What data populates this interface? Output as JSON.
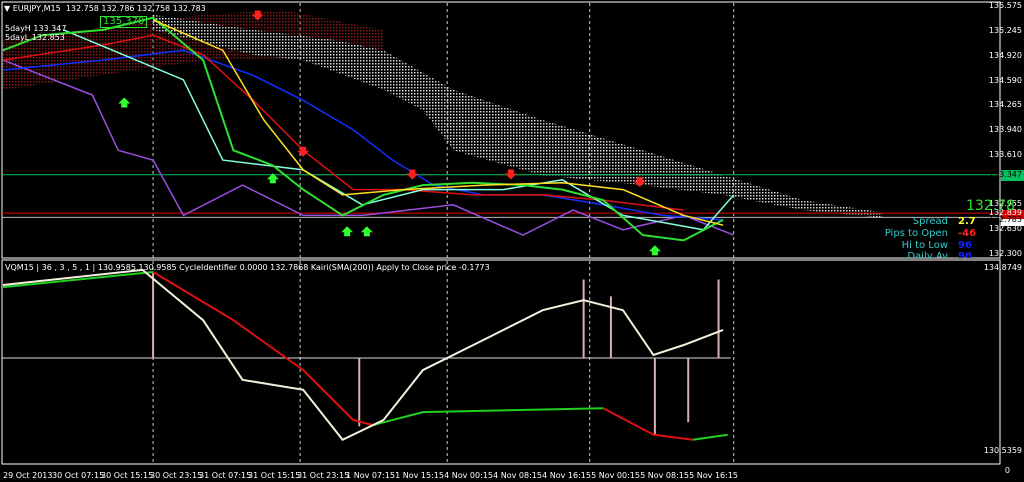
{
  "header": {
    "symbol": "EURJPY,M15",
    "ohlc": "132.758 132.786 132.758 132.783",
    "high_label": "5dayH 133.347",
    "low_label": "5dayL 132.853",
    "marker_price": "135.370"
  },
  "price_axis": {
    "labels": [
      "135.575",
      "135.245",
      "134.920",
      "134.590",
      "134.265",
      "133.940",
      "133.610",
      "133.347",
      "132.955",
      "132.839",
      "132.783",
      "132.630",
      "132.300"
    ],
    "min": 132.3,
    "max": 135.575
  },
  "levels": {
    "five_day_high": 133.347,
    "bid": 132.839,
    "last": 132.783,
    "green": "#00c060",
    "red": "#e00000"
  },
  "info_panel": {
    "price": "132.78",
    "spread_label": "Spread",
    "spread": "2.7",
    "pips_label": "Pips to Open",
    "pips": "-46",
    "hilo_label": "Hi to Low",
    "hilo": "96",
    "daily_label": "Daily Av",
    "daily": "96"
  },
  "lower": {
    "title": "VQM15 | 36 , 3 , 5 , 1 |  130.9585 130.9585 CycleIdentifier 0.0000 132.7868  Kairi(SMA(200)) Apply to Close price -0.1773",
    "max_label": "134.8749",
    "min_label": "130.5359",
    "min": 130.5359,
    "max": 134.8749,
    "zero_label": "0"
  },
  "time_axis": [
    "29 Oct 2013",
    "30 Oct 07:15",
    "30 Oct 15:15",
    "30 Oct 23:15",
    "31 Oct 07:15",
    "31 Oct 15:15",
    "31 Oct 23:15",
    "1 Nov 07:15",
    "1 Nov 15:15",
    "4 Nov 00:15",
    "4 Nov 08:15",
    "4 Nov 16:15",
    "5 Nov 00:15",
    "5 Nov 08:15",
    "5 Nov 16:15"
  ],
  "chart_data": {
    "type": "line",
    "bars_per_label": 32,
    "upper": {
      "series": [
        {
          "name": "cloud-maroon-top",
          "color": "#8b1a1a",
          "points": [
            [
              0,
              135.13
            ],
            [
              132,
              135.46
            ],
            [
              185,
              135.52
            ],
            [
              251,
              135.26
            ]
          ]
        },
        {
          "name": "cloud-maroon-bottom",
          "color": "#8b1a1a",
          "points": [
            [
              0,
              134.47
            ],
            [
              132,
              134.86
            ],
            [
              185,
              134.86
            ],
            [
              251,
              134.86
            ]
          ]
        },
        {
          "name": "cloud-top",
          "color": "#d8d8d8",
          "points": [
            [
              99,
              135.46
            ],
            [
              165,
              135.26
            ],
            [
              218,
              135.13
            ],
            [
              251,
              134.99
            ],
            [
              297,
              134.47
            ],
            [
              356,
              134.07
            ],
            [
              422,
              133.67
            ],
            [
              475,
              133.34
            ],
            [
              528,
              133.01
            ],
            [
              580,
              132.85
            ]
          ]
        },
        {
          "name": "cloud-bottom",
          "color": "#d8d8d8",
          "points": [
            [
              99,
              135.26
            ],
            [
              165,
              134.93
            ],
            [
              198,
              134.86
            ],
            [
              251,
              134.47
            ],
            [
              277,
              134.2
            ],
            [
              297,
              133.67
            ],
            [
              356,
              133.34
            ],
            [
              422,
              133.21
            ],
            [
              475,
              133.08
            ],
            [
              528,
              132.88
            ],
            [
              580,
              132.78
            ]
          ]
        },
        {
          "name": "purple",
          "color": "#9a4ee0",
          "points": [
            [
              0,
              134.86
            ],
            [
              59,
              134.4
            ],
            [
              76,
              133.67
            ],
            [
              99,
              133.54
            ],
            [
              119,
              132.81
            ],
            [
              158,
              133.21
            ],
            [
              198,
              132.81
            ],
            [
              237,
              132.81
            ],
            [
              297,
              132.95
            ],
            [
              343,
              132.55
            ],
            [
              376,
              132.88
            ],
            [
              409,
              132.62
            ],
            [
              449,
              132.81
            ],
            [
              482,
              132.55
            ]
          ]
        },
        {
          "name": "blue",
          "color": "#1030ff",
          "points": [
            [
              0,
              134.73
            ],
            [
              66,
              134.86
            ],
            [
              119,
              134.99
            ],
            [
              165,
              134.66
            ],
            [
              198,
              134.33
            ],
            [
              231,
              133.94
            ],
            [
              257,
              133.54
            ],
            [
              284,
              133.21
            ],
            [
              317,
              133.08
            ],
            [
              356,
              133.08
            ],
            [
              396,
              132.95
            ],
            [
              435,
              132.81
            ],
            [
              475,
              132.75
            ]
          ]
        },
        {
          "name": "red",
          "color": "#e01010",
          "points": [
            [
              0,
              134.86
            ],
            [
              66,
              135.06
            ],
            [
              99,
              135.19
            ],
            [
              132,
              134.93
            ],
            [
              165,
              134.33
            ],
            [
              198,
              133.67
            ],
            [
              231,
              133.15
            ],
            [
              264,
              133.15
            ],
            [
              310,
              133.08
            ],
            [
              356,
              133.08
            ],
            [
              396,
              133.01
            ],
            [
              449,
              132.88
            ]
          ]
        },
        {
          "name": "cyan",
          "color": "#80ffe0",
          "points": [
            [
              40,
              135.26
            ],
            [
              119,
              134.6
            ],
            [
              145,
              133.54
            ],
            [
              198,
              133.41
            ],
            [
              237,
              132.95
            ],
            [
              277,
              133.15
            ],
            [
              330,
              133.15
            ],
            [
              369,
              133.28
            ],
            [
              409,
              132.81
            ],
            [
              462,
              132.62
            ],
            [
              482,
              133.08
            ]
          ]
        },
        {
          "name": "price",
          "color": "#30e030",
          "points": [
            [
              0,
              134.99
            ],
            [
              26,
              135.19
            ],
            [
              66,
              135.26
            ],
            [
              99,
              135.42
            ],
            [
              132,
              134.86
            ],
            [
              152,
              133.67
            ],
            [
              178,
              133.47
            ],
            [
              198,
              133.15
            ],
            [
              224,
              132.81
            ],
            [
              251,
              133.08
            ],
            [
              277,
              133.21
            ],
            [
              310,
              133.24
            ],
            [
              343,
              133.21
            ],
            [
              369,
              133.15
            ],
            [
              396,
              133.01
            ],
            [
              422,
              132.55
            ],
            [
              449,
              132.48
            ],
            [
              475,
              132.75
            ]
          ]
        },
        {
          "name": "yellow",
          "color": "#ffe020",
          "points": [
            [
              99,
              135.39
            ],
            [
              145,
              134.99
            ],
            [
              172,
              134.07
            ],
            [
              198,
              133.41
            ],
            [
              224,
              133.08
            ],
            [
              264,
              133.15
            ],
            [
              317,
              133.21
            ],
            [
              369,
              133.24
            ],
            [
              409,
              133.15
            ],
            [
              449,
              132.81
            ],
            [
              475,
              132.68
            ]
          ]
        }
      ],
      "arrows": [
        {
          "bar": 168,
          "price": 135.45,
          "dir": "down"
        },
        {
          "bar": 198,
          "price": 133.65,
          "dir": "down"
        },
        {
          "bar": 270,
          "price": 133.35,
          "dir": "down"
        },
        {
          "bar": 335,
          "price": 133.35,
          "dir": "down"
        },
        {
          "bar": 420,
          "price": 133.25,
          "dir": "down"
        },
        {
          "bar": 80,
          "price": 134.3,
          "dir": "up"
        },
        {
          "bar": 178,
          "price": 133.3,
          "dir": "up"
        },
        {
          "bar": 227,
          "price": 132.6,
          "dir": "up"
        },
        {
          "bar": 240,
          "price": 132.6,
          "dir": "up"
        },
        {
          "bar": 430,
          "price": 132.35,
          "dir": "up"
        }
      ]
    },
    "lower": {
      "baseline": 132.73,
      "main": {
        "color": "#f5f0dc",
        "points": [
          [
            0,
            134.47
          ],
          [
            92,
            134.83
          ],
          [
            132,
            133.63
          ],
          [
            158,
            132.21
          ],
          [
            198,
            131.97
          ],
          [
            224,
            130.78
          ],
          [
            251,
            131.25
          ],
          [
            277,
            132.44
          ],
          [
            317,
            133.16
          ],
          [
            356,
            133.87
          ],
          [
            383,
            134.11
          ],
          [
            409,
            133.87
          ],
          [
            429,
            132.8
          ],
          [
            449,
            133.04
          ],
          [
            475,
            133.4
          ]
        ]
      },
      "signal": [
        {
          "color": "#20d020",
          "points": [
            [
              0,
              134.42
            ],
            [
              99,
              134.78
            ]
          ]
        },
        {
          "color": "#e01010",
          "points": [
            [
              99,
              134.78
            ],
            [
              152,
              133.63
            ],
            [
              198,
              132.44
            ],
            [
              231,
              131.25
            ],
            [
              244,
              131.13
            ]
          ]
        },
        {
          "color": "#20d020",
          "points": [
            [
              244,
              131.13
            ],
            [
              277,
              131.44
            ],
            [
              396,
              131.53
            ]
          ]
        },
        {
          "color": "#e01010",
          "points": [
            [
              396,
              131.53
            ],
            [
              429,
              130.9
            ],
            [
              455,
              130.78
            ]
          ]
        },
        {
          "color": "#20d020",
          "points": [
            [
              455,
              130.78
            ],
            [
              478,
              130.9
            ]
          ]
        }
      ],
      "spikes": [
        [
          99,
          134.78
        ],
        [
          235,
          131.1
        ],
        [
          383,
          134.6
        ],
        [
          401,
          134.2
        ],
        [
          430,
          130.9
        ],
        [
          452,
          131.2
        ],
        [
          472,
          134.6
        ]
      ]
    }
  }
}
